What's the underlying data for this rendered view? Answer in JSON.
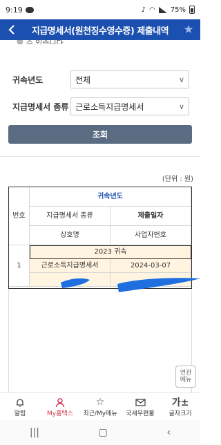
{
  "status_bar": {
    "time": "9:19",
    "battery": "75%"
  },
  "app_bar": {
    "title": "지급명세서(원천징수영수증) 제출내역",
    "back_icon": "chevron-left-icon",
    "favorite_icon": "star-icon"
  },
  "truncated_text": "할 수 있습니다.",
  "filters": {
    "year_label": "귀속년도",
    "year_value": "전체",
    "type_label": "지급명세서 종류",
    "type_value": "근로소득지급명세서"
  },
  "search_button_label": "조회",
  "unit_label": "(단위 : 원)",
  "table": {
    "headers": {
      "no": "번호",
      "year": "귀속년도",
      "type": "지급명세서 종류",
      "submit_date": "제출일자",
      "company": "상호명",
      "biz_no": "사업자번호"
    },
    "rows": [
      {
        "group": "2023 귀속",
        "no": "1",
        "type": "근로소득지급명세서",
        "submit_date": "2024-03-07",
        "company": "",
        "biz_no": ""
      }
    ]
  },
  "related_menu_label": "연관\n메뉴",
  "bottom_nav": [
    {
      "label": "알림",
      "icon": "bell-icon",
      "active": false
    },
    {
      "label": "My홈택스",
      "icon": "person-icon",
      "active": true
    },
    {
      "label": "최근/My메뉴",
      "icon": "star-outline-icon",
      "active": false
    },
    {
      "label": "국세우편물",
      "icon": "mail-icon",
      "active": false
    },
    {
      "label": "글자크기",
      "icon": "font-size-icon",
      "active": false
    }
  ],
  "colors": {
    "primary": "#1b4fb0",
    "button": "#5a6b82",
    "highlight_row": "#fff4e0",
    "active_nav": "#d0334a"
  }
}
